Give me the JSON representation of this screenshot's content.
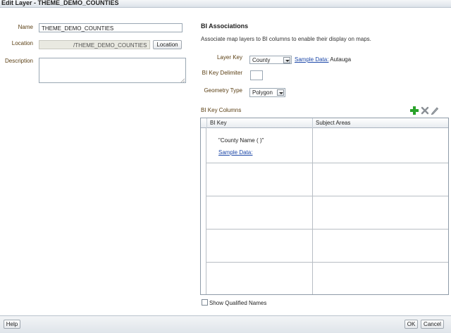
{
  "window": {
    "title": "Edit Layer - THEME_DEMO_COUNTIES"
  },
  "form": {
    "name_label": "Name",
    "name_value": "THEME_DEMO_COUNTIES",
    "location_label": "Location",
    "location_value": "/THEME_DEMO_COUNTIES",
    "location_button": "Location",
    "description_label": "Description",
    "description_value": ""
  },
  "bi": {
    "title": "BI Associations",
    "description": "Associate map layers to BI columns to enable their display on maps.",
    "layer_key_label": "Layer Key",
    "layer_key_value": "County",
    "sample_data_label": "Sample Data:",
    "sample_data_value": "Autauga",
    "delimiter_label": "BI Key Delimiter",
    "delimiter_value": "",
    "geometry_label": "Geometry Type",
    "geometry_value": "Polygon",
    "columns_label": "BI Key Columns",
    "toolbar": {
      "add_icon": "plus-icon",
      "delete_icon": "x-icon",
      "edit_icon": "pencil-icon"
    },
    "table": {
      "headers": [
        "BI Key",
        "Subject Areas"
      ],
      "rows": [
        {
          "bi_key": "\"County Name (      )\"",
          "sample_link": "Sample Data:",
          "subject_area": ""
        }
      ]
    },
    "show_qualified_label": "Show Qualified Names"
  },
  "footer": {
    "help": "Help",
    "ok": "OK",
    "cancel": "Cancel"
  },
  "colors": {
    "accent": "#1d48a8",
    "label": "#5a3e12",
    "add": "#2aa22a"
  }
}
